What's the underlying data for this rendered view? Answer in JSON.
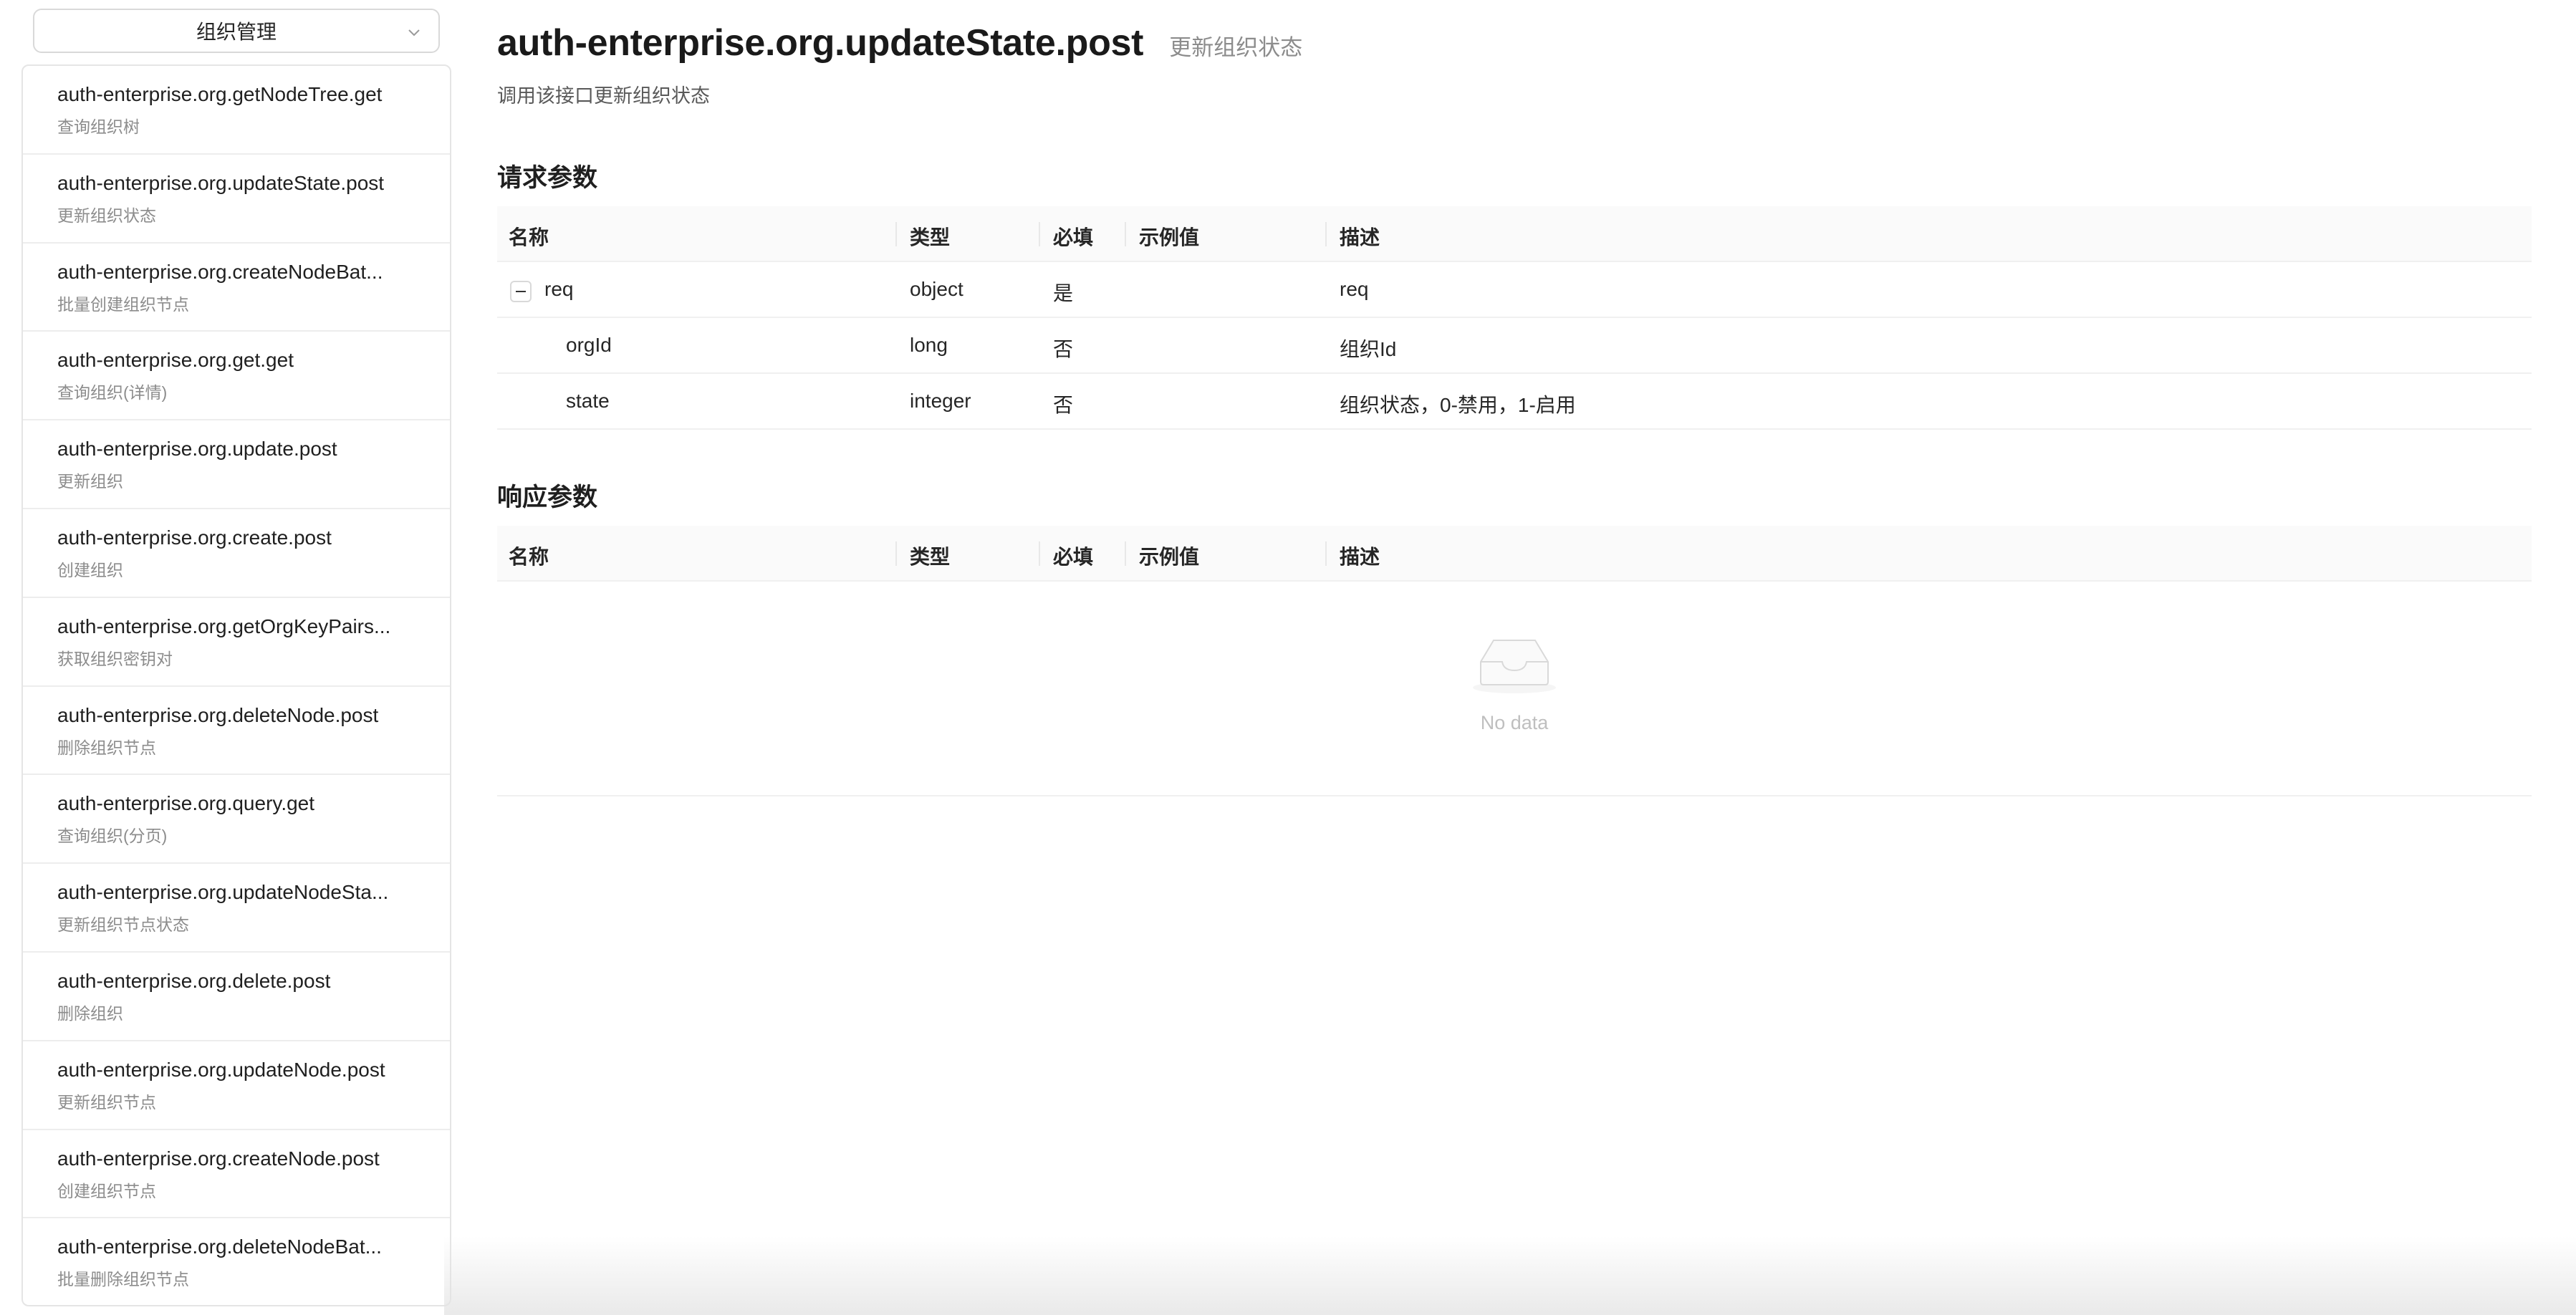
{
  "sidebar": {
    "select_value": "组织管理",
    "items": [
      {
        "title": "auth-enterprise.org.getNodeTree.get",
        "sub": "查询组织树"
      },
      {
        "title": "auth-enterprise.org.updateState.post",
        "sub": "更新组织状态"
      },
      {
        "title": "auth-enterprise.org.createNodeBat...",
        "sub": "批量创建组织节点"
      },
      {
        "title": "auth-enterprise.org.get.get",
        "sub": "查询组织(详情)"
      },
      {
        "title": "auth-enterprise.org.update.post",
        "sub": "更新组织"
      },
      {
        "title": "auth-enterprise.org.create.post",
        "sub": "创建组织"
      },
      {
        "title": "auth-enterprise.org.getOrgKeyPairs...",
        "sub": "获取组织密钥对"
      },
      {
        "title": "auth-enterprise.org.deleteNode.post",
        "sub": "删除组织节点"
      },
      {
        "title": "auth-enterprise.org.query.get",
        "sub": "查询组织(分页)"
      },
      {
        "title": "auth-enterprise.org.updateNodeSta...",
        "sub": "更新组织节点状态"
      },
      {
        "title": "auth-enterprise.org.delete.post",
        "sub": "删除组织"
      },
      {
        "title": "auth-enterprise.org.updateNode.post",
        "sub": "更新组织节点"
      },
      {
        "title": "auth-enterprise.org.createNode.post",
        "sub": "创建组织节点"
      },
      {
        "title": "auth-enterprise.org.deleteNodeBat...",
        "sub": "批量删除组织节点"
      }
    ]
  },
  "main": {
    "title": "auth-enterprise.org.updateState.post",
    "subtitle": "更新组织状态",
    "description": "调用该接口更新组织状态",
    "columns": {
      "name": "名称",
      "type": "类型",
      "required": "必填",
      "example": "示例值",
      "desc": "描述"
    },
    "request": {
      "title": "请求参数",
      "rows": [
        {
          "name": "req",
          "type": "object",
          "required": "是",
          "example": "",
          "desc": "req"
        },
        {
          "name": "orgId",
          "type": "long",
          "required": "否",
          "example": "",
          "desc": "组织Id"
        },
        {
          "name": "state",
          "type": "integer",
          "required": "否",
          "example": "",
          "desc": "组织状态，0-禁用，1-启用"
        }
      ]
    },
    "response": {
      "title": "响应参数",
      "empty_text": "No data"
    }
  }
}
